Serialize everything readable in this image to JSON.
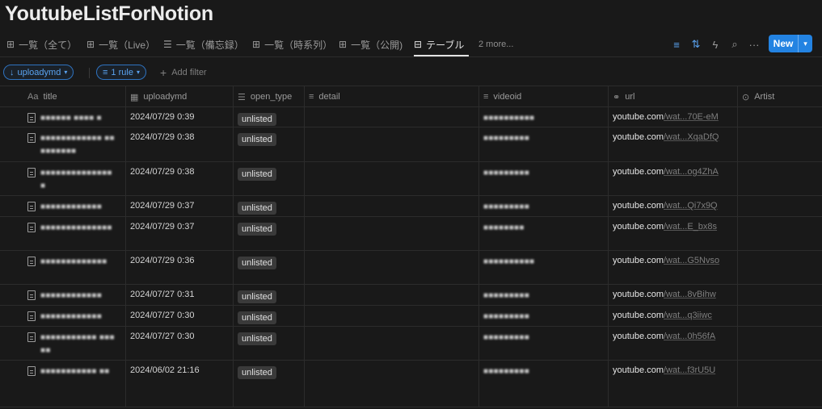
{
  "page": {
    "title": "YoutubeListForNotion"
  },
  "views": {
    "tabs": [
      {
        "label": "一覧（全て）",
        "icon": "grid-icon"
      },
      {
        "label": "一覧（Live）",
        "icon": "grid-icon"
      },
      {
        "label": "一覧（備忘録）",
        "icon": "list-icon"
      },
      {
        "label": "一覧（時系列）",
        "icon": "grid-icon"
      },
      {
        "label": "一覧（公開)",
        "icon": "grid-icon"
      },
      {
        "label": "テーブル",
        "icon": "table-icon"
      }
    ],
    "more": "2 more...",
    "active_index": 5
  },
  "toolbar": {
    "new_label": "New"
  },
  "colors": {
    "accent": "#2383e2",
    "background": "#191919",
    "badge": "#3a3a3a"
  },
  "filters": {
    "sort_chip": "uploadymd",
    "rule_chip": "1 rule",
    "add_filter": "Add filter"
  },
  "table": {
    "columns": [
      {
        "label": "title",
        "icon": "Aa"
      },
      {
        "label": "uploadymd",
        "icon": "calendar-icon"
      },
      {
        "label": "open_type",
        "icon": "multiselect-icon"
      },
      {
        "label": "detail",
        "icon": "text-icon"
      },
      {
        "label": "videoid",
        "icon": "text-icon"
      },
      {
        "label": "url",
        "icon": "link-icon"
      },
      {
        "label": "Artist",
        "icon": "relation-icon"
      }
    ],
    "rows": [
      {
        "title": "■■■■■■ ■■■■ ■",
        "uploadymd": "2024/07/29 0:39",
        "open_type": "unlisted",
        "videoid": "■■■■■■■■■■",
        "url_host": "youtube.com",
        "url_rest": "/wat...70E-eM"
      },
      {
        "title": "■■■■■■■■■■■■ ■■■■■■■■■",
        "uploadymd": "2024/07/29 0:38",
        "open_type": "unlisted",
        "videoid": "■■■■■■■■■",
        "url_host": "youtube.com",
        "url_rest": "/wat...XqaDfQ"
      },
      {
        "title": "■■■■■■■■■■■■■■■",
        "uploadymd": "2024/07/29 0:38",
        "open_type": "unlisted",
        "videoid": "■■■■■■■■■",
        "url_host": "youtube.com",
        "url_rest": "/wat...og4ZhA"
      },
      {
        "title": "■■■■■■■■■■■■",
        "uploadymd": "2024/07/29 0:37",
        "open_type": "unlisted",
        "videoid": "■■■■■■■■■",
        "url_host": "youtube.com",
        "url_rest": "/wat...Qi7x9Q"
      },
      {
        "title": "■■■■■■■■■■■■■■",
        "uploadymd": "2024/07/29 0:37",
        "open_type": "unlisted",
        "videoid": "■■■■■■■■",
        "url_host": "youtube.com",
        "url_rest": "/wat...E_bx8s"
      },
      {
        "title": "■■■■■■■■■■■■■",
        "uploadymd": "2024/07/29 0:36",
        "open_type": "unlisted",
        "videoid": "■■■■■■■■■■",
        "url_host": "youtube.com",
        "url_rest": "/wat...G5Nvso"
      },
      {
        "title": "■■■■■■■■■■■■",
        "uploadymd": "2024/07/27 0:31",
        "open_type": "unlisted",
        "videoid": "■■■■■■■■■",
        "url_host": "youtube.com",
        "url_rest": "/wat...8vBihw"
      },
      {
        "title": "■■■■■■■■■■■■",
        "uploadymd": "2024/07/27 0:30",
        "open_type": "unlisted",
        "videoid": "■■■■■■■■■",
        "url_host": "youtube.com",
        "url_rest": "/wat...q3iiwc"
      },
      {
        "title": "■■■■■■■■■■■ ■■■■■",
        "uploadymd": "2024/07/27 0:30",
        "open_type": "unlisted",
        "videoid": "■■■■■■■■■",
        "url_host": "youtube.com",
        "url_rest": "/wat...0h56fA"
      },
      {
        "title": "■■■■■■■■■■■ ■■",
        "uploadymd": "2024/06/02 21:16",
        "open_type": "unlisted",
        "videoid": "■■■■■■■■■",
        "url_host": "youtube.com",
        "url_rest": "/wat...f3rU5U"
      }
    ]
  }
}
